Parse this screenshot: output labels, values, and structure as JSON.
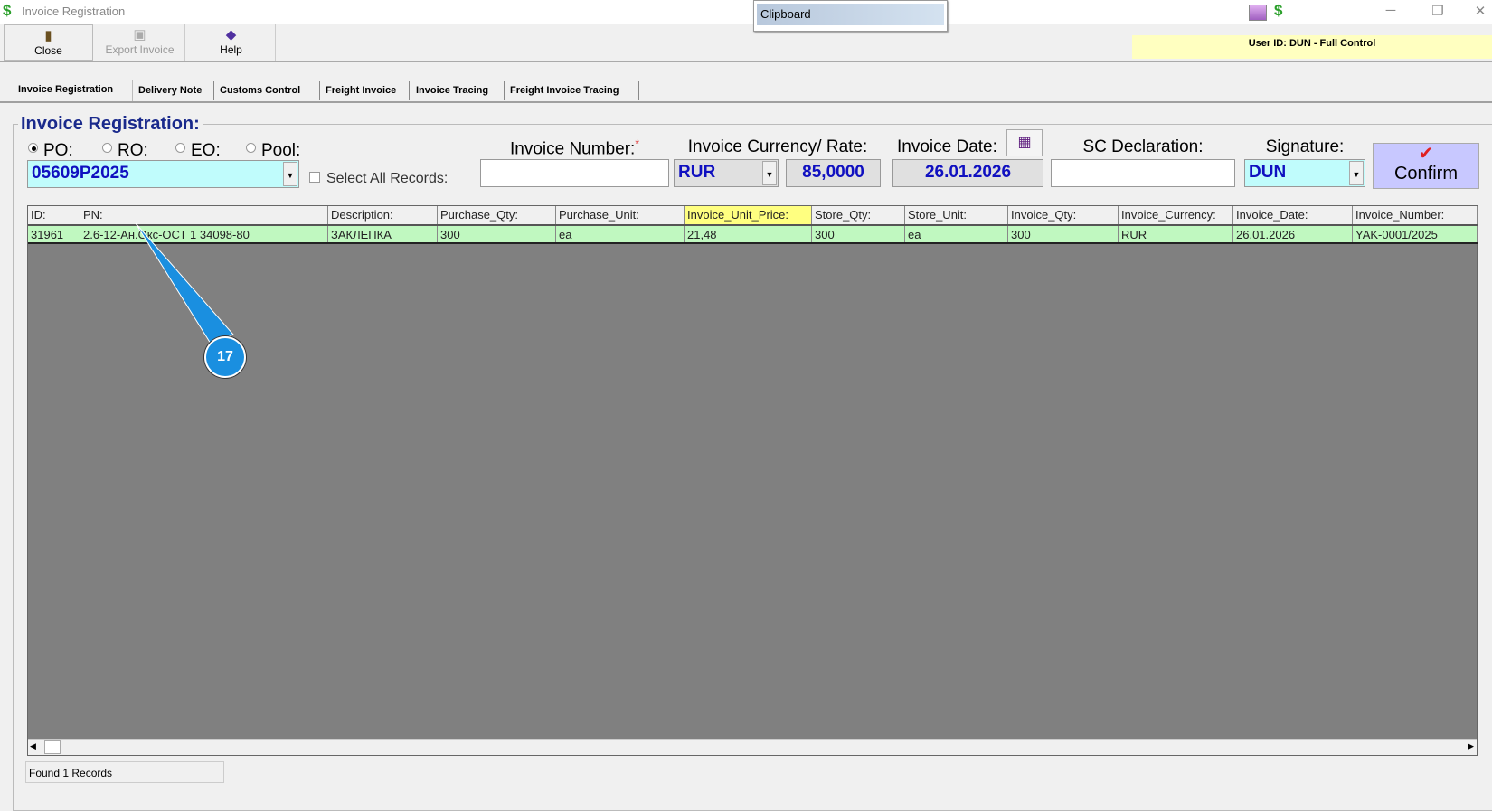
{
  "window": {
    "title": "Invoice Registration",
    "clipboard": "Clipboard",
    "minimize": "─",
    "restore": "❐",
    "close": "✕"
  },
  "toolbar": {
    "close": "Close",
    "export": "Export Invoice",
    "help": "Help"
  },
  "user_id": "User ID: DUN - Full Control",
  "tabs": [
    "Invoice Registration",
    "Delivery Note",
    "Customs Control",
    "Freight Invoice",
    "Invoice Tracing",
    "Freight Invoice Tracing"
  ],
  "form": {
    "title": "Invoice Registration:",
    "radios": [
      "PO:",
      "RO:",
      "EO:",
      "Pool:"
    ],
    "order_value": "05609P2025",
    "select_all": "Select All Records:",
    "invoice_number_label": "Invoice Number:",
    "required_mark": "*",
    "invoice_number": "",
    "currency_label": "Invoice Currency/ Rate:",
    "currency": "RUR",
    "rate": "85,0000",
    "date_label": "Invoice Date:",
    "date": "26.01.2026",
    "sc_label": "SC Declaration:",
    "sc_value": "",
    "signature_label": "Signature:",
    "signature": "DUN",
    "confirm": "Confirm"
  },
  "grid": {
    "columns": [
      "ID:",
      "PN:",
      "Description:",
      "Purchase_Qty:",
      "Purchase_Unit:",
      "Invoice_Unit_Price:",
      "Store_Qty:",
      "Store_Unit:",
      "Invoice_Qty:",
      "Invoice_Currency:",
      "Invoice_Date:",
      "Invoice_Number:"
    ],
    "rows": [
      [
        "31961",
        "2.6-12-Ан.Окс-ОСТ 1 34098-80",
        "ЗАКЛЕПКА",
        "300",
        "ea",
        "21,48",
        "300",
        "ea",
        "300",
        "RUR",
        "26.01.2026",
        "YAK-0001/2025"
      ]
    ]
  },
  "status": "Found 1 Records",
  "callout": "17"
}
